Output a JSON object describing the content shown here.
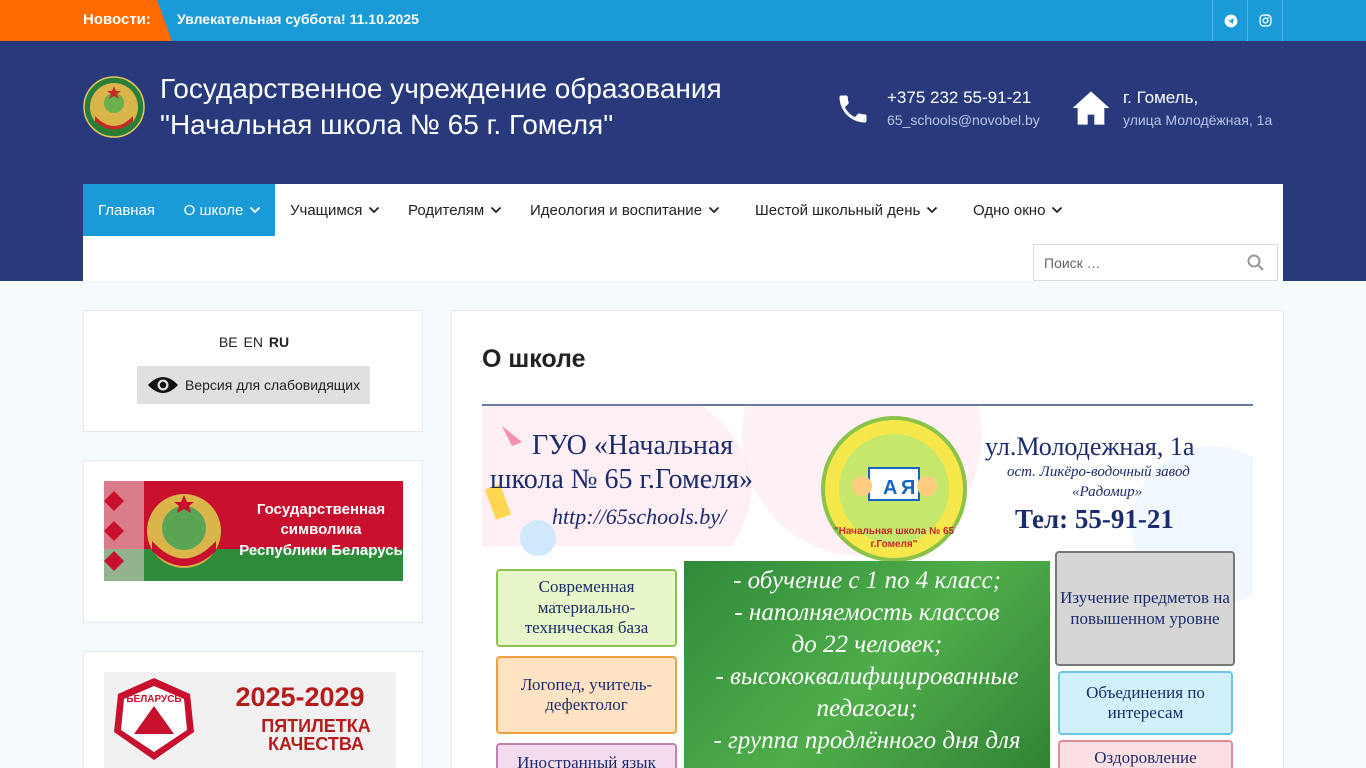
{
  "topbar": {
    "news_label": "Новости:",
    "news_text": "Увлекательная суббота! 11.10.2025",
    "social": [
      "telegram-icon",
      "instagram-icon"
    ]
  },
  "header": {
    "title_line1": "Государственное учреждение образования",
    "title_line2": "\"Начальная школа № 65 г. Гомеля\"",
    "phone": "+375 232 55-91-21",
    "email": "65_schools@novobel.by",
    "city": "г. Гомель,",
    "street": "улица Молодёжная, 1а"
  },
  "nav": {
    "items": [
      {
        "label": "Главная",
        "dropdown": false,
        "active": true
      },
      {
        "label": "О школе",
        "dropdown": true,
        "active": true
      },
      {
        "label": "Учащимся",
        "dropdown": true,
        "active": false
      },
      {
        "label": "Родителям",
        "dropdown": true,
        "active": false
      },
      {
        "label": "Идеология и воспитание",
        "dropdown": true,
        "active": false
      },
      {
        "label": "Шестой школьный день",
        "dropdown": true,
        "active": false
      },
      {
        "label": "Одно окно",
        "dropdown": true,
        "active": false
      }
    ],
    "search_placeholder": "Поиск …"
  },
  "sidebar": {
    "languages": [
      "BE",
      "EN",
      "RU"
    ],
    "current_language": "RU",
    "accessibility_label": "Версия для слабовидящих",
    "banner1": {
      "line1": "Государственная",
      "line2": "символика",
      "line3": "Республики Беларусь"
    },
    "banner2": {
      "years": "2025-2029",
      "line1": "ПЯТИЛЕТКА",
      "line2": "КАЧЕСТВА",
      "badge": "БЕЛАРУСЬ"
    }
  },
  "main": {
    "page_title": "О школе",
    "poster": {
      "school_name_line1": "ГУО «Начальная",
      "school_name_line2": "школа № 65 г.Гомеля»",
      "site": "http://65schools.by/",
      "address": "ул.Молодежная, 1а",
      "stop_line1": "ост. Ликёро-водочный завод",
      "stop_line2": "«Радомир»",
      "phone": "Тел: 55-91-21",
      "logo_caption_line1": "\"Начальная школа № 65",
      "logo_caption_line2": "г.Гомеля\"",
      "green_lines": [
        "- обучение с 1 по 4 класс;",
        "- наполняемость классов",
        "до 22 человек;",
        "- высококвалифицированные",
        "педагоги;",
        "- группа продлённого дня для"
      ],
      "left_scrolls": [
        "Современная материально-техническая база",
        "Логопед, учитель-дефектолог",
        "Иностранный язык"
      ],
      "right_scrolls": [
        "Изучение предметов на повышенном уровне",
        "Объединения по интересам",
        "Оздоровление"
      ]
    }
  }
}
